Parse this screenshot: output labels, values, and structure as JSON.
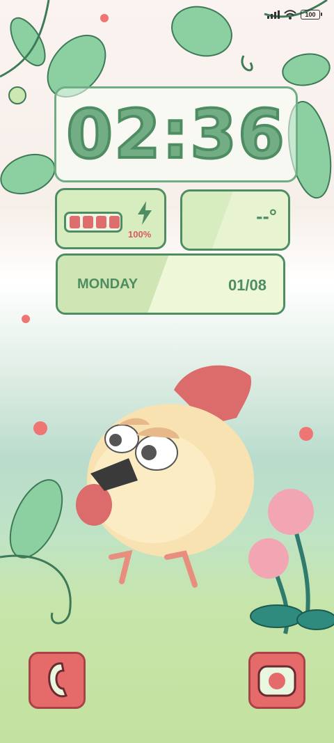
{
  "statusbar": {
    "battery_level": "100",
    "icons": [
      "signal-icon",
      "wifi-icon",
      "battery-icon"
    ]
  },
  "clock": {
    "time": "02:36"
  },
  "battery_widget": {
    "percent_label": "100%",
    "level": 1.0,
    "segments": 4,
    "icon": "lightning-bolt-icon"
  },
  "weather_widget": {
    "temperature": "--°"
  },
  "date_widget": {
    "day": "MONDAY",
    "date": "01/08"
  },
  "dock": {
    "left_app": "phone-icon",
    "right_app": "camera-icon"
  },
  "colors": {
    "accent_green": "#4e8d62",
    "card_green": "#d7ecbf",
    "app_red": "#e56b6b"
  }
}
